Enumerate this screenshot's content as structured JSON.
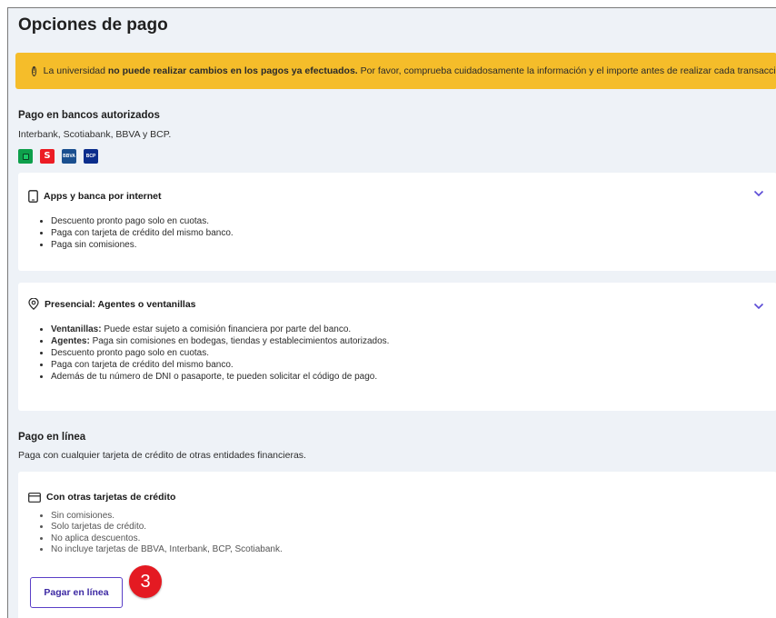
{
  "page": {
    "title": "Opciones de pago"
  },
  "alert": {
    "icon": "exclamation-circle-icon",
    "text_pre": "La universidad ",
    "text_bold": "no puede realizar cambios en los pagos ya efectuados.",
    "text_post": " Por favor, comprueba cuidadosamente la información y el importe antes de realizar cada transacción.",
    "background": "#f5bd2a"
  },
  "bank_section": {
    "title": "Pago en bancos autorizados",
    "subtitle": "Interbank, Scotiabank, BBVA y BCP.",
    "logos": [
      {
        "name": "interbank",
        "icon": "interbank-logo-icon"
      },
      {
        "name": "scotiabank",
        "icon": "scotiabank-logo-icon",
        "glyph": "S"
      },
      {
        "name": "bbva",
        "icon": "bbva-logo-icon",
        "glyph": "BBVA"
      },
      {
        "name": "bcp",
        "icon": "bcp-logo-icon",
        "glyph": "BCP"
      }
    ]
  },
  "apps_card": {
    "icon": "mobile-phone-icon",
    "title": "Apps y banca por internet",
    "items": [
      "Descuento pronto pago solo en cuotas.",
      "Paga con tarjeta de crédito del mismo banco.",
      "Paga sin comisiones."
    ]
  },
  "presencial_card": {
    "icon": "location-pin-icon",
    "title": "Presencial: Agentes o ventanillas",
    "items": [
      {
        "bold": "Ventanillas:",
        "text": " Puede estar sujeto a comisión financiera por parte del banco."
      },
      {
        "bold": "Agentes:",
        "text": " Paga sin comisiones en bodegas, tiendas y establecimientos autorizados."
      },
      {
        "bold": "",
        "text": "Descuento pronto pago solo en cuotas."
      },
      {
        "bold": "",
        "text": "Paga con tarjeta de crédito del mismo banco."
      },
      {
        "bold": "",
        "text": "Además de tu número de DNI o pasaporte, te pueden solicitar el código de pago."
      }
    ]
  },
  "online_section": {
    "title": "Pago en línea",
    "subtitle": "Paga con cualquier tarjeta de crédito de otras entidades financieras."
  },
  "credit_card": {
    "icon": "credit-card-icon",
    "title": "Con otras tarjetas de crédito",
    "items": [
      "Sin comisiones.",
      "Solo tarjetas de crédito.",
      "No aplica descuentos.",
      "No incluye tarjetas de BBVA, Interbank, BCP, Scotiabank."
    ],
    "button_label": "Pagar en línea"
  },
  "step_badge": {
    "label": "3",
    "color": "#e41a22"
  },
  "colors": {
    "panel_bg": "#eef2f7",
    "accent_purple": "#5a3fc7",
    "chevron": "#5b4bd6"
  }
}
